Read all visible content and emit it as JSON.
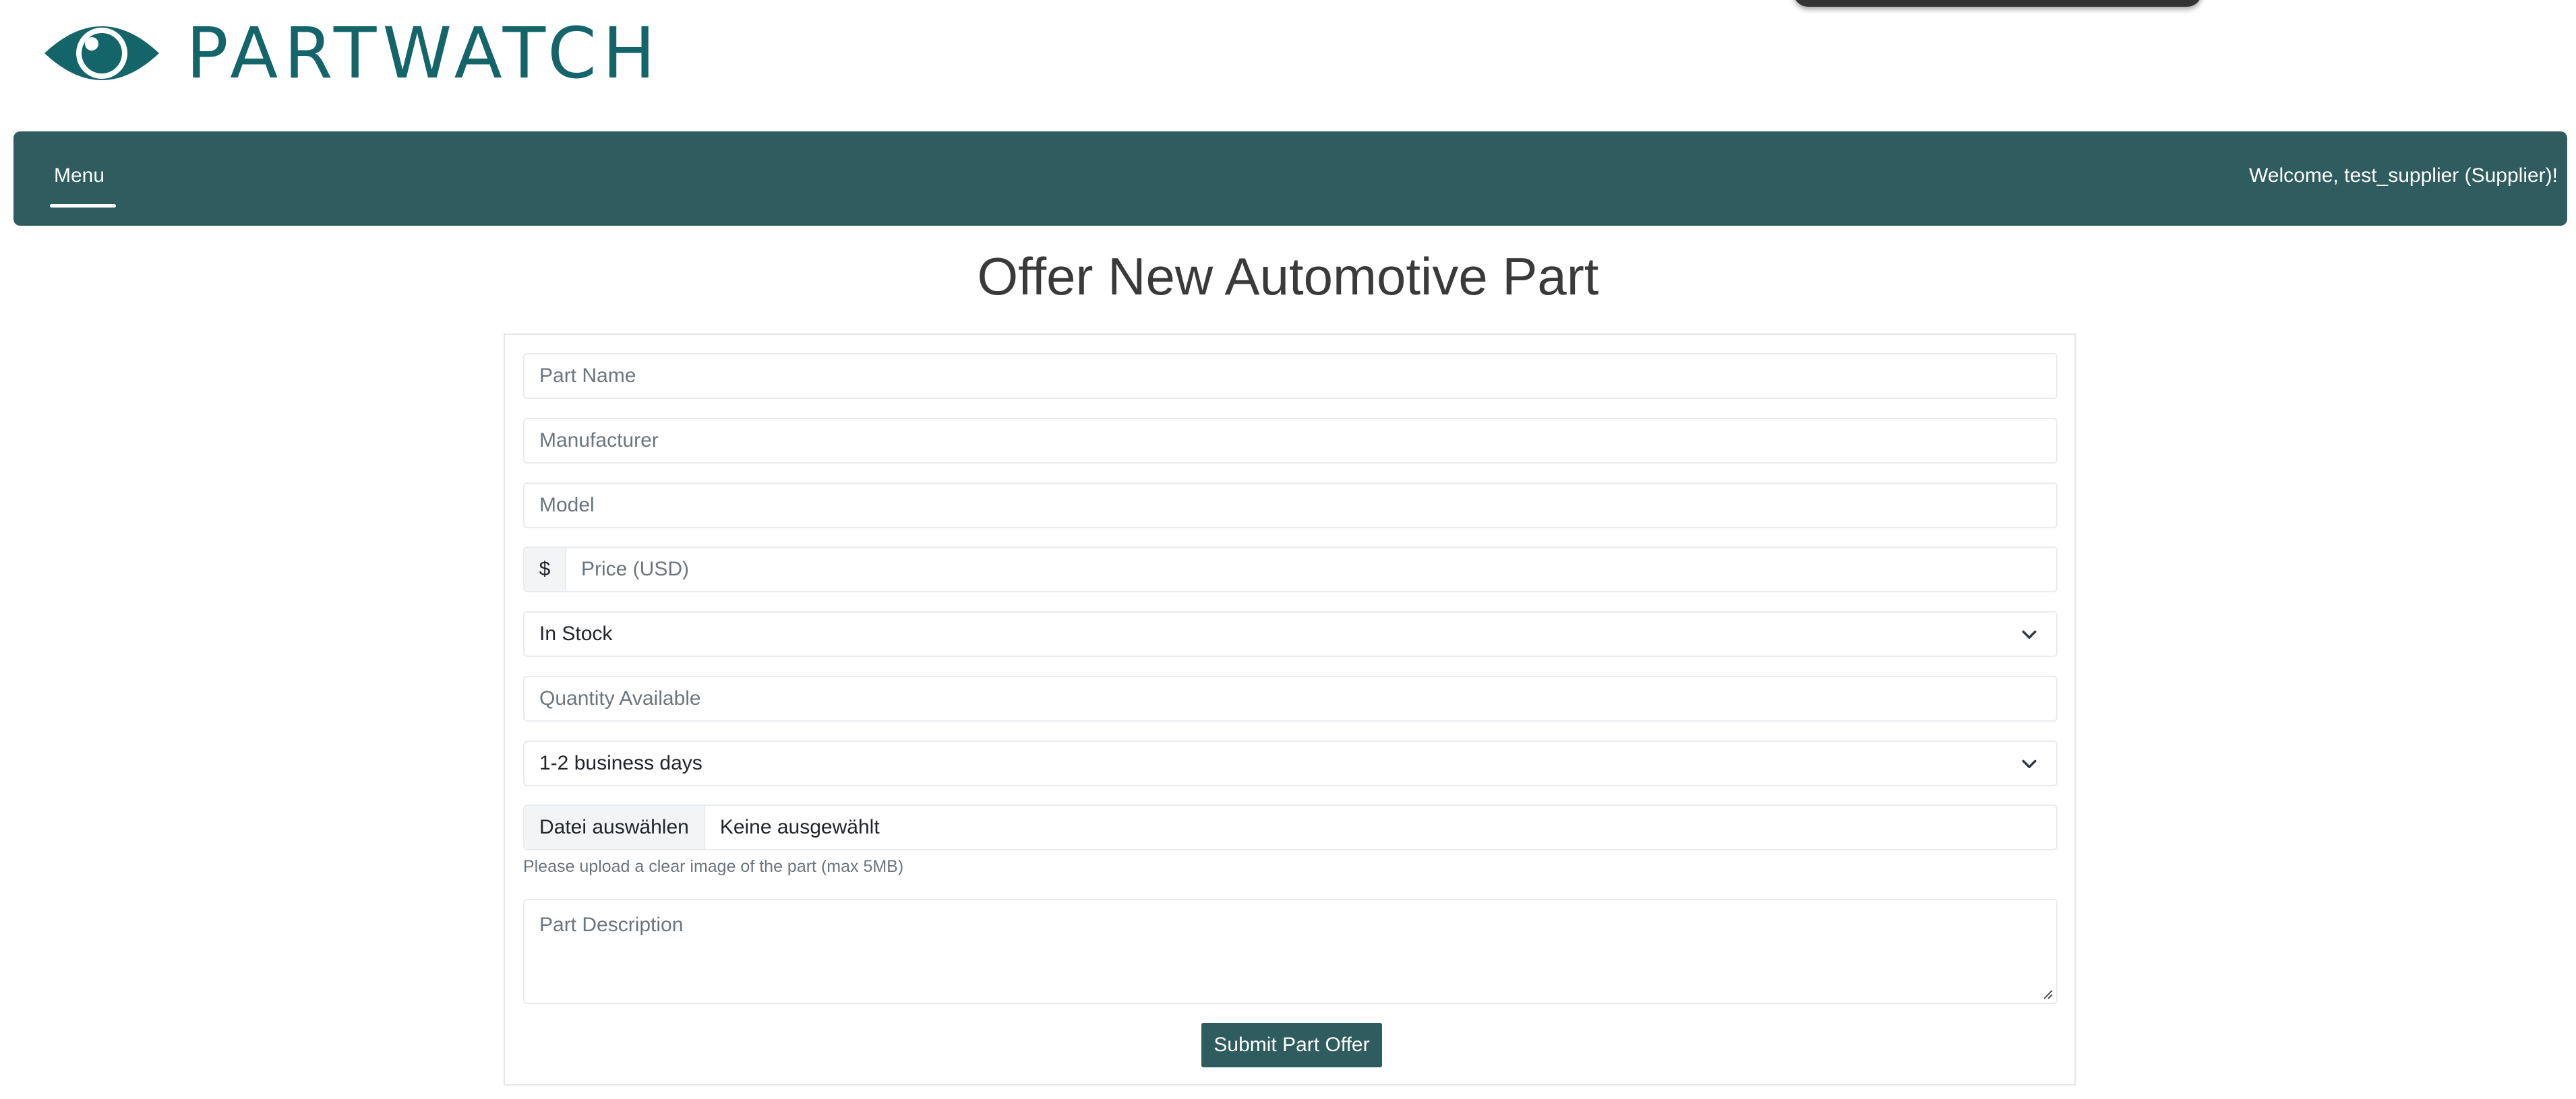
{
  "brand": {
    "name": "PARTWATCH",
    "color": "#14656a",
    "logo_icon": "eye-icon"
  },
  "navbar": {
    "menu_label": "Menu",
    "welcome_text": "Welcome, test_supplier (Supplier)!",
    "background": "#2f5c5f"
  },
  "page": {
    "title": "Offer New Automotive Part"
  },
  "form": {
    "part_name": {
      "placeholder": "Part Name",
      "value": ""
    },
    "manufacturer": {
      "placeholder": "Manufacturer",
      "value": ""
    },
    "model": {
      "placeholder": "Model",
      "value": ""
    },
    "price": {
      "prefix": "$",
      "placeholder": "Price (USD)",
      "value": ""
    },
    "availability": {
      "selected": "In Stock"
    },
    "quantity": {
      "placeholder": "Quantity Available",
      "value": ""
    },
    "delivery_time": {
      "selected": "1-2 business days"
    },
    "image_upload": {
      "button_label": "Datei auswählen",
      "file_status": "Keine ausgewählt",
      "help_text": "Please upload a clear image of the part (max 5MB)"
    },
    "description": {
      "placeholder": "Part Description",
      "value": ""
    },
    "submit_label": "Submit Part Offer"
  }
}
